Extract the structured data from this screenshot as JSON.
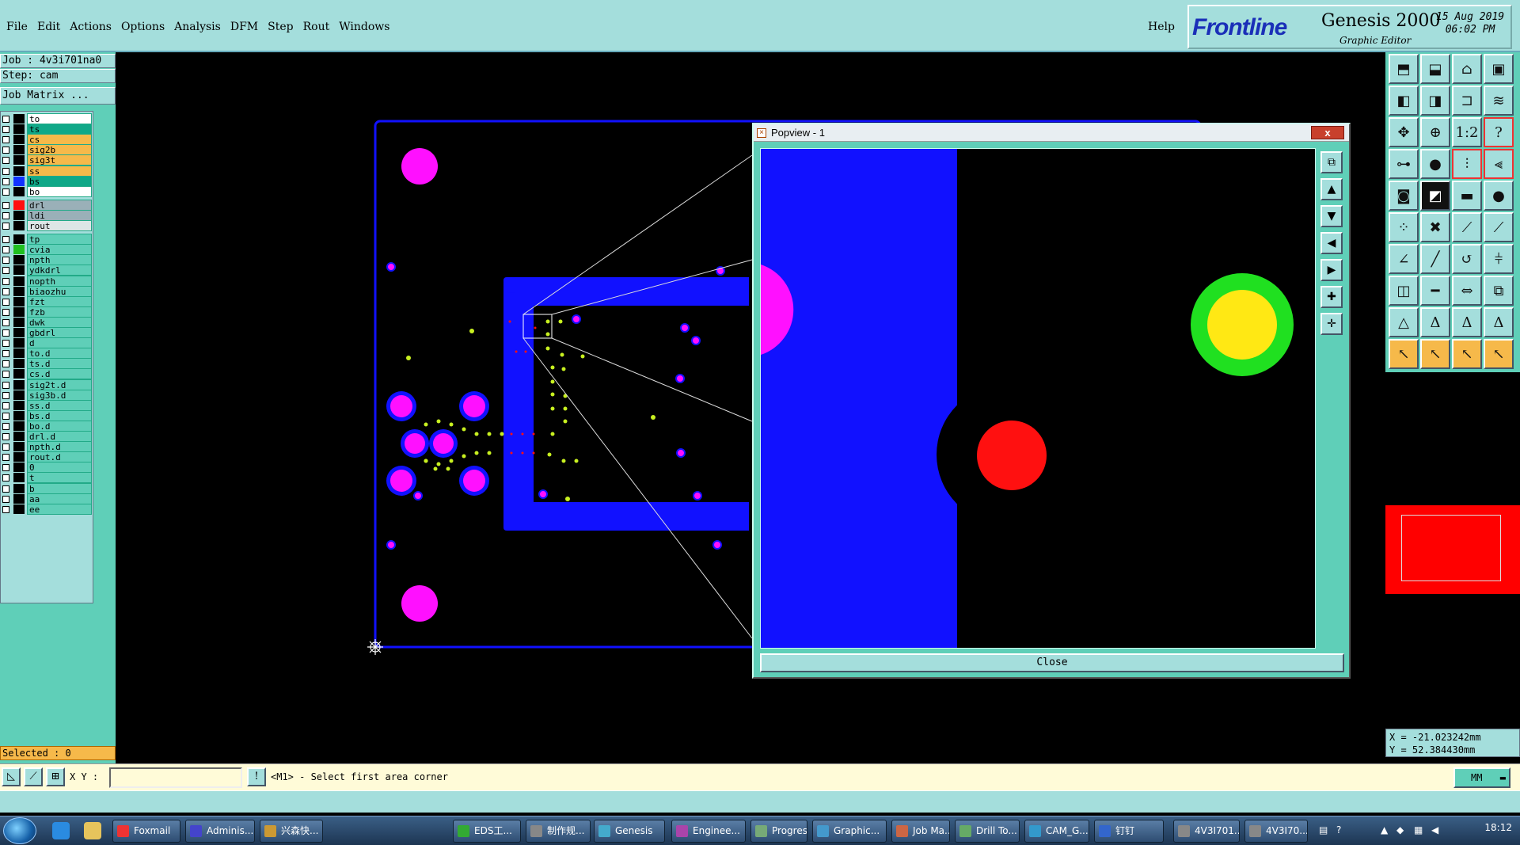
{
  "menubar": {
    "items": [
      "File",
      "Edit",
      "Actions",
      "Options",
      "Analysis",
      "DFM",
      "Step",
      "Rout",
      "Windows"
    ],
    "help": "Help"
  },
  "brand": {
    "logo": "Frontline",
    "product": "Genesis 2000",
    "subtitle": "Graphic Editor",
    "date": "15 Aug 2019",
    "time": "06:02 PM"
  },
  "job": {
    "job_line": "Job : 4v3i701na0",
    "step_line": "Step: cam",
    "matrix_button": "Job Matrix ..."
  },
  "layers": [
    {
      "name": "to",
      "color": "#ffffff",
      "swatch": "#000000"
    },
    {
      "name": "ts",
      "color": "#10a888",
      "swatch": "#000000"
    },
    {
      "name": "cs",
      "color": "#f6b94a",
      "swatch": "#000000"
    },
    {
      "name": "sig2b",
      "color": "#f6b94a",
      "swatch": "#000000"
    },
    {
      "name": "sig3t",
      "color": "#f6b94a",
      "swatch": "#000000"
    },
    {
      "name": "ss",
      "color": "#f6b94a",
      "swatch": "#000000"
    },
    {
      "name": "bs",
      "color": "#10a888",
      "swatch": "#1133ff"
    },
    {
      "name": "bo",
      "color": "#ffffff",
      "swatch": "#000000"
    },
    {
      "name": "drl",
      "color": "#9ab0b8",
      "swatch": "#ff1010"
    },
    {
      "name": "ldi",
      "color": "#9ab0b8",
      "swatch": "#000000"
    },
    {
      "name": "rout",
      "color": "#dde6e6",
      "swatch": "#000000"
    },
    {
      "name": "tp",
      "color": "#5fcfb8",
      "swatch": "#000000"
    },
    {
      "name": "cvia",
      "color": "#5fcfb8",
      "swatch": "#20c020"
    },
    {
      "name": "npth",
      "color": "#5fcfb8",
      "swatch": "#000000"
    },
    {
      "name": "ydkdrl",
      "color": "#5fcfb8",
      "swatch": "#000000"
    },
    {
      "name": "nopth",
      "color": "#5fcfb8",
      "swatch": "#000000"
    },
    {
      "name": "biaozhu",
      "color": "#5fcfb8",
      "swatch": "#000000"
    },
    {
      "name": "fzt",
      "color": "#5fcfb8",
      "swatch": "#000000"
    },
    {
      "name": "fzb",
      "color": "#5fcfb8",
      "swatch": "#000000"
    },
    {
      "name": "dwk",
      "color": "#5fcfb8",
      "swatch": "#000000"
    },
    {
      "name": "gbdrl",
      "color": "#5fcfb8",
      "swatch": "#000000"
    },
    {
      "name": "d",
      "color": "#5fcfb8",
      "swatch": "#000000"
    },
    {
      "name": "to.d",
      "color": "#5fcfb8",
      "swatch": "#000000"
    },
    {
      "name": "ts.d",
      "color": "#5fcfb8",
      "swatch": "#000000"
    },
    {
      "name": "cs.d",
      "color": "#5fcfb8",
      "swatch": "#000000"
    },
    {
      "name": "sig2t.d",
      "color": "#5fcfb8",
      "swatch": "#000000"
    },
    {
      "name": "sig3b.d",
      "color": "#5fcfb8",
      "swatch": "#000000"
    },
    {
      "name": "ss.d",
      "color": "#5fcfb8",
      "swatch": "#000000"
    },
    {
      "name": "bs.d",
      "color": "#5fcfb8",
      "swatch": "#000000"
    },
    {
      "name": "bo.d",
      "color": "#5fcfb8",
      "swatch": "#000000"
    },
    {
      "name": "drl.d",
      "color": "#5fcfb8",
      "swatch": "#000000"
    },
    {
      "name": "npth.d",
      "color": "#5fcfb8",
      "swatch": "#000000"
    },
    {
      "name": "rout.d",
      "color": "#5fcfb8",
      "swatch": "#000000"
    },
    {
      "name": "0",
      "color": "#5fcfb8",
      "swatch": "#000000"
    },
    {
      "name": "t",
      "color": "#5fcfb8",
      "swatch": "#000000"
    },
    {
      "name": "b",
      "color": "#5fcfb8",
      "swatch": "#000000"
    },
    {
      "name": "aa",
      "color": "#5fcfb8",
      "swatch": "#000000"
    },
    {
      "name": "ee",
      "color": "#5fcfb8",
      "swatch": "#000000"
    }
  ],
  "selected": "Selected : 0",
  "popview": {
    "title": "Popview - 1",
    "close_x": "x",
    "close_button": "Close"
  },
  "coords": {
    "x": "X = -21.023242mm",
    "y": "Y = 52.384430mm"
  },
  "cmdbar": {
    "xy_label": "X Y :",
    "xy_value": "",
    "prompt": "<M1> - Select first area corner",
    "unit": "MM"
  },
  "taskbar": {
    "tasks": [
      "Foxmail",
      "Adminis...",
      "兴森快...",
      "EDS工...",
      "制作规...",
      "Genesis",
      "Enginee...",
      "Progress",
      "Graphic...",
      "Job Ma...",
      "Drill To...",
      "CAM_G...",
      "钉钉",
      "4V3I701...",
      "4V3I70..."
    ],
    "clock": "18:12"
  },
  "colors": {
    "panel": "#5fcfb8",
    "menubar": "#a4dedc",
    "copper_blue": "#1111ff",
    "pad_magenta": "#ff10ff",
    "via_yellow": "#c8f020",
    "drill_red": "#ff1010"
  }
}
